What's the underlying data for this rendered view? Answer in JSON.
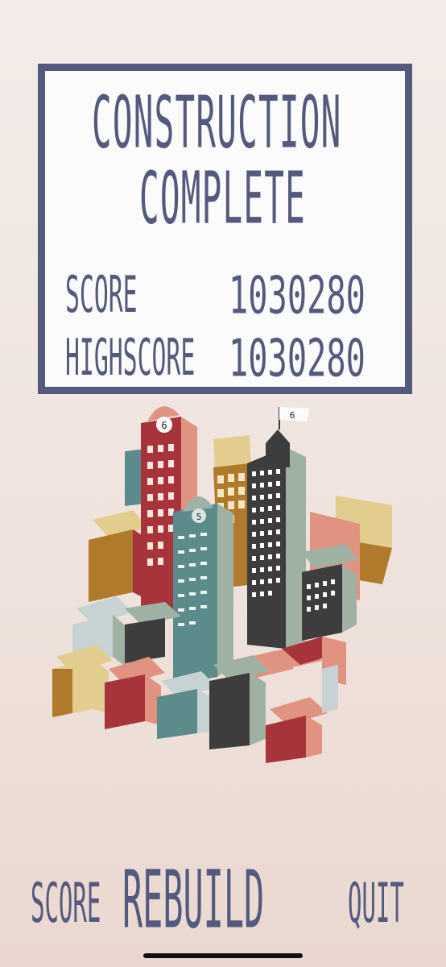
{
  "results_panel": {
    "title_line1": "CONSTRUCTION",
    "title_line2": "COMPLETE",
    "score_label": "SCORE",
    "score_value": "1030280",
    "highscore_label": "HIGHSCORE",
    "highscore_value": "1030280"
  },
  "city_flags": {
    "tower_left_label": "6",
    "tower_middle_label": "5",
    "tower_right_flag_label": "6"
  },
  "bottom_menu": {
    "score_label": "SCORE",
    "rebuild_label": "REBUILD",
    "quit_label": "QUIT"
  },
  "colors": {
    "ink": "#545a7d",
    "panel_bg": "#fcfbfb",
    "red": "#a8343b",
    "salmon": "#e09381",
    "teal": "#5b8b8a",
    "sage": "#9fb1a3",
    "charcoal": "#3d3d3d",
    "sand": "#e2cd8f",
    "ochre": "#b07a2c"
  }
}
